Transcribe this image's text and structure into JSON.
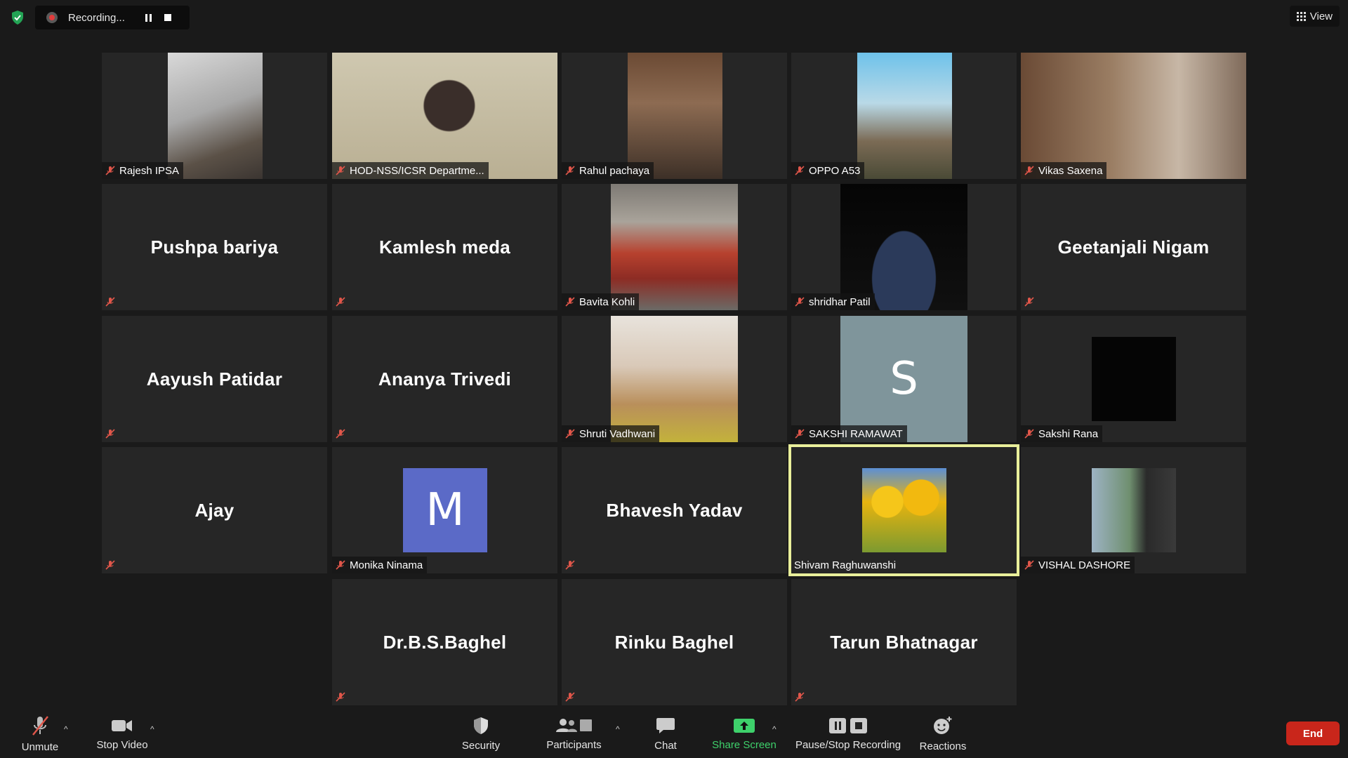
{
  "topbar": {
    "recording_label": "Recording...",
    "view_label": "View"
  },
  "participants": [
    {
      "name": "Rajesh IPSA"
    },
    {
      "name": "HOD-NSS/ICSR Departme..."
    },
    {
      "name": "Rahul pachaya"
    },
    {
      "name": "OPPO A53"
    },
    {
      "name": "Vikas Saxena"
    },
    {
      "name": "Pushpa bariya"
    },
    {
      "name": "Kamlesh meda"
    },
    {
      "name": "Bavita Kohli"
    },
    {
      "name": "shridhar Patil"
    },
    {
      "name": "Geetanjali Nigam"
    },
    {
      "name": "Aayush Patidar"
    },
    {
      "name": "Ananya Trivedi"
    },
    {
      "name": "Shruti Vadhwani"
    },
    {
      "name": "SAKSHI RAMAWAT",
      "avatar_letter": "S"
    },
    {
      "name": "Sakshi Rana"
    },
    {
      "name": "Ajay"
    },
    {
      "name": "Monika Ninama",
      "avatar_letter": "M"
    },
    {
      "name": "Bhavesh Yadav"
    },
    {
      "name": "Shivam Raghuwanshi"
    },
    {
      "name": "VISHAL DASHORE"
    },
    {
      "name": "Dr.B.S.Baghel"
    },
    {
      "name": "Rinku Baghel"
    },
    {
      "name": "Tarun Bhatnagar"
    }
  ],
  "toolbar": {
    "unmute": "Unmute",
    "stop_video": "Stop Video",
    "security": "Security",
    "participants": "Participants",
    "chat": "Chat",
    "share_screen": "Share Screen",
    "pause_stop_recording": "Pause/Stop Recording",
    "reactions": "Reactions",
    "end": "End"
  },
  "colors": {
    "speaking_border": "#e9ef9a",
    "end_button": "#c9261b",
    "share_green": "#3ed16b",
    "monika_avatar": "#5b6ac7",
    "sakshi_avatar": "#7f959b"
  }
}
